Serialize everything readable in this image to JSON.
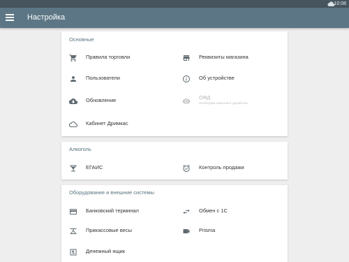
{
  "status_bar": {
    "time": "10:08",
    "icon": "cloud-icon"
  },
  "app_bar": {
    "title": "Настройка",
    "menu_icon": "menu-icon"
  },
  "sections": {
    "basic": {
      "title": "Основные",
      "items": [
        {
          "label": "Правила торговли",
          "icon": "cart-icon"
        },
        {
          "label": "Реквизиты магазина",
          "icon": "store-icon"
        },
        {
          "label": "Пользователи",
          "icon": "person-icon"
        },
        {
          "label": "Об устройстве",
          "icon": "info-icon"
        },
        {
          "label": "Обновление",
          "icon": "cloud-download-icon"
        },
        {
          "label": "ОФД",
          "sub": "Необходим компонент доработки",
          "icon": "eye-icon",
          "disabled": true
        },
        {
          "label": "Кабинет Дримкас",
          "icon": "cloud-outline-icon"
        }
      ]
    },
    "alcohol": {
      "title": "Алкоголь",
      "items": [
        {
          "label": "ЕГАИС",
          "icon": "glass-icon"
        },
        {
          "label": "Контроль продажи",
          "icon": "alarm-clock-icon"
        }
      ]
    },
    "equipment": {
      "title": "Оборудование и внешние системы",
      "items": [
        {
          "label": "Банковский терминал",
          "icon": "credit-card-icon"
        },
        {
          "label": "Обмен с 1С",
          "icon": "swap-icon"
        },
        {
          "label": "Прикассовые весы",
          "icon": "scale-icon"
        },
        {
          "label": "Prisma",
          "icon": "video-camera-icon"
        },
        {
          "label": "Денежный ящик",
          "icon": "cash-drawer-icon"
        }
      ]
    }
  },
  "colors": {
    "status_bar": "#47555f",
    "app_bar": "#5c7685",
    "section_title": "#57727f",
    "icon": "#5f6a70",
    "icon_disabled": "#c2c2c2",
    "background": "#eeeeee"
  }
}
